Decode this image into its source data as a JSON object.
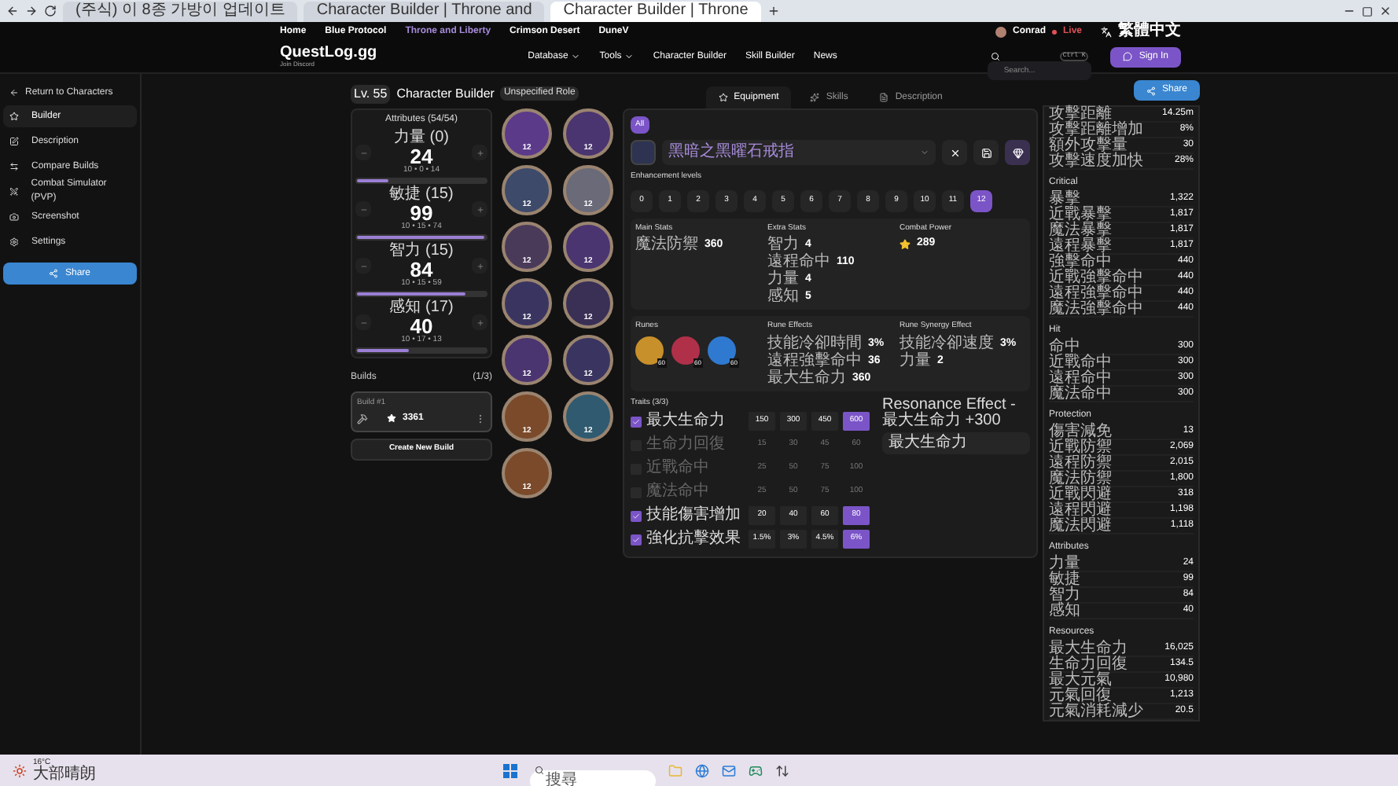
{
  "browser": {
    "tabs": [
      {
        "title": "(주식) 이 8종 가방이 업데이트",
        "selected": false
      },
      {
        "title": "Character Builder | Throne and",
        "selected": false
      },
      {
        "title": "Character Builder | Throne",
        "selected": true
      }
    ]
  },
  "site": {
    "games": [
      {
        "label": "Home",
        "selected": false
      },
      {
        "label": "Blue Protocol",
        "selected": false
      },
      {
        "label": "Throne and Liberty",
        "selected": true
      },
      {
        "label": "Crimson Desert",
        "selected": false
      },
      {
        "label": "DuneV",
        "selected": false
      }
    ],
    "user": "Conrad",
    "live": "Live",
    "language": "繁體中文",
    "logo": "QuestLog.gg",
    "discord": "Join Discord",
    "nav": [
      {
        "label": "Database",
        "dropdown": true
      },
      {
        "label": "Tools",
        "dropdown": true
      },
      {
        "label": "Character Builder",
        "dropdown": false
      },
      {
        "label": "Skill Builder",
        "dropdown": false
      },
      {
        "label": "News",
        "dropdown": false
      }
    ],
    "search": {
      "placeholder": "Search...",
      "shortcut": "Ctrl K"
    },
    "sign_in": "Sign In"
  },
  "sidebar": {
    "back": "Return to Characters",
    "items": [
      {
        "label": "Builder",
        "selected": true
      },
      {
        "label": "Description",
        "selected": false
      },
      {
        "label": "Compare Builds",
        "selected": false
      },
      {
        "label": "Combat Simulator (PVP)",
        "selected": false
      },
      {
        "label": "Screenshot",
        "selected": false
      },
      {
        "label": "Settings",
        "selected": false
      }
    ],
    "share": "Share"
  },
  "header": {
    "level": "Lv. 55",
    "title": "Character Builder",
    "role": "Unspecified Role"
  },
  "attributes": {
    "title": "Attributes (54/54)",
    "items": [
      {
        "name": "力量 (0)",
        "value": "24",
        "breakdown": "10 • 0 • 14",
        "level": 0.24
      },
      {
        "name": "敏捷 (15)",
        "value": "99",
        "breakdown": "10 • 15 • 74",
        "level": 0.99
      },
      {
        "name": "智力 (15)",
        "value": "84",
        "breakdown": "10 • 15 • 59",
        "level": 0.84
      },
      {
        "name": "感知 (17)",
        "value": "40",
        "breakdown": "10 • 17 • 13",
        "level": 0.4
      }
    ]
  },
  "builds": {
    "title": "Builds",
    "count": "(1/3)",
    "items": [
      {
        "name": "Build #1",
        "score": "3361",
        "selected": true
      }
    ],
    "create": "Create New Build"
  },
  "slots": [
    {
      "enhancement": "12",
      "color": "#5b3a8a"
    },
    {
      "enhancement": "12",
      "color": "#4a3570"
    },
    {
      "enhancement": "12",
      "color": "#3d4a6a"
    },
    {
      "enhancement": "12",
      "color": "#6a6a78"
    },
    {
      "enhancement": "12",
      "color": "#4a3a5a"
    },
    {
      "enhancement": "12",
      "color": "#4a3570"
    },
    {
      "enhancement": "12",
      "color": "#3a3560"
    },
    {
      "enhancement": "12",
      "color": "#3a2f55"
    },
    {
      "enhancement": "12",
      "color": "#4a3570"
    },
    {
      "enhancement": "12",
      "color": "#3a3560"
    },
    {
      "enhancement": "12",
      "color": "#7a4a2a"
    },
    {
      "enhancement": "12",
      "color": "#2f5a70"
    },
    {
      "enhancement": "12",
      "color": "#7a4a2a"
    }
  ],
  "equipment": {
    "tabs": [
      {
        "label": "Equipment",
        "selected": true
      },
      {
        "label": "Skills",
        "selected": false
      },
      {
        "label": "Description",
        "selected": false
      }
    ],
    "filter": {
      "label": "All",
      "selected": true
    },
    "item": {
      "name": "黑暗之黑曜石戒指"
    },
    "enhancement": {
      "title": "Enhancement levels",
      "levels": [
        {
          "label": "0",
          "selected": false
        },
        {
          "label": "1",
          "selected": false
        },
        {
          "label": "2",
          "selected": false
        },
        {
          "label": "3",
          "selected": false
        },
        {
          "label": "4",
          "selected": false
        },
        {
          "label": "5",
          "selected": false
        },
        {
          "label": "6",
          "selected": false
        },
        {
          "label": "7",
          "selected": false
        },
        {
          "label": "8",
          "selected": false
        },
        {
          "label": "9",
          "selected": false
        },
        {
          "label": "10",
          "selected": false
        },
        {
          "label": "11",
          "selected": false
        },
        {
          "label": "12",
          "selected": true
        }
      ]
    },
    "stat_groups": [
      {
        "title": "Main Stats",
        "rows": [
          {
            "name": "魔法防禦",
            "value": "360"
          }
        ]
      },
      {
        "title": "Extra Stats",
        "rows": [
          {
            "name": "智力",
            "value": "4"
          },
          {
            "name": "遠程命中",
            "value": "110"
          },
          {
            "name": "力量",
            "value": "4"
          },
          {
            "name": "感知",
            "value": "5"
          }
        ]
      }
    ],
    "combat_power": {
      "title": "Combat Power",
      "value": "289"
    },
    "runes": {
      "title": "Runes",
      "items": [
        {
          "level": "60",
          "color": "#c8902a"
        },
        {
          "level": "60",
          "color": "#b0304a"
        },
        {
          "level": "60",
          "color": "#2f7ad0"
        }
      ]
    },
    "rune_groups": [
      {
        "title": "Rune Effects",
        "rows": [
          {
            "name": "技能冷卻時間",
            "value": "3%"
          },
          {
            "name": "遠程強擊命中",
            "value": "36"
          },
          {
            "name": "最大生命力",
            "value": "360"
          }
        ]
      },
      {
        "title": "Rune Synergy Effect",
        "rows": [
          {
            "name": "技能冷卻速度",
            "value": "3%"
          },
          {
            "name": "力量",
            "value": "2"
          }
        ]
      }
    ],
    "traits": {
      "title": "Traits (3/3)",
      "rows": [
        {
          "name": "最大生命力",
          "checked": true,
          "values": [
            {
              "label": "150",
              "selected": false
            },
            {
              "label": "300",
              "selected": false
            },
            {
              "label": "450",
              "selected": false
            },
            {
              "label": "600",
              "selected": true
            }
          ]
        },
        {
          "name": "生命力回復",
          "checked": false,
          "values": [
            {
              "label": "15",
              "selected": false
            },
            {
              "label": "30",
              "selected": false
            },
            {
              "label": "45",
              "selected": false
            },
            {
              "label": "60",
              "selected": false
            }
          ]
        },
        {
          "name": "近戰命中",
          "checked": false,
          "values": [
            {
              "label": "25",
              "selected": false
            },
            {
              "label": "50",
              "selected": false
            },
            {
              "label": "75",
              "selected": false
            },
            {
              "label": "100",
              "selected": false
            }
          ]
        },
        {
          "name": "魔法命中",
          "checked": false,
          "values": [
            {
              "label": "25",
              "selected": false
            },
            {
              "label": "50",
              "selected": false
            },
            {
              "label": "75",
              "selected": false
            },
            {
              "label": "100",
              "selected": false
            }
          ]
        },
        {
          "name": "技能傷害增加",
          "checked": true,
          "values": [
            {
              "label": "20",
              "selected": false
            },
            {
              "label": "40",
              "selected": false
            },
            {
              "label": "60",
              "selected": false
            },
            {
              "label": "80",
              "selected": true
            }
          ]
        },
        {
          "name": "強化抗擊效果",
          "checked": true,
          "values": [
            {
              "label": "1.5%",
              "selected": false
            },
            {
              "label": "3%",
              "selected": false
            },
            {
              "label": "4.5%",
              "selected": false
            },
            {
              "label": "6%",
              "selected": true
            }
          ]
        }
      ]
    },
    "resonance": {
      "title": "Resonance Effect - 最大生命力 +300",
      "value": "最大生命力"
    }
  },
  "stats_panel": {
    "share": "Share",
    "sections": [
      {
        "rows": [
          {
            "name": "攻擊距離",
            "value": "14.25m"
          },
          {
            "name": "攻擊距離增加",
            "value": "8%"
          },
          {
            "name": "額外攻擊量",
            "value": "30"
          },
          {
            "name": "攻擊速度加快",
            "value": "28%"
          }
        ]
      },
      {
        "title": "Critical",
        "rows": [
          {
            "name": "暴擊",
            "value": "1,322"
          },
          {
            "name": "近戰暴擊",
            "value": "1,817"
          },
          {
            "name": "魔法暴擊",
            "value": "1,817"
          },
          {
            "name": "遠程暴擊",
            "value": "1,817"
          },
          {
            "name": "強擊命中",
            "value": "440"
          },
          {
            "name": "近戰強擊命中",
            "value": "440"
          },
          {
            "name": "遠程強擊命中",
            "value": "440"
          },
          {
            "name": "魔法強擊命中",
            "value": "440"
          }
        ]
      },
      {
        "title": "Hit",
        "rows": [
          {
            "name": "命中",
            "value": "300"
          },
          {
            "name": "近戰命中",
            "value": "300"
          },
          {
            "name": "遠程命中",
            "value": "300"
          },
          {
            "name": "魔法命中",
            "value": "300"
          }
        ]
      },
      {
        "title": "Protection",
        "rows": [
          {
            "name": "傷害減免",
            "value": "13"
          },
          {
            "name": "近戰防禦",
            "value": "2,069"
          },
          {
            "name": "遠程防禦",
            "value": "2,015"
          },
          {
            "name": "魔法防禦",
            "value": "1,800"
          },
          {
            "name": "近戰閃避",
            "value": "318"
          },
          {
            "name": "遠程閃避",
            "value": "1,198"
          },
          {
            "name": "魔法閃避",
            "value": "1,118"
          }
        ]
      },
      {
        "title": "Attributes",
        "rows": [
          {
            "name": "力量",
            "value": "24"
          },
          {
            "name": "敏捷",
            "value": "99"
          },
          {
            "name": "智力",
            "value": "84"
          },
          {
            "name": "感知",
            "value": "40"
          }
        ]
      },
      {
        "title": "Resources",
        "rows": [
          {
            "name": "最大生命力",
            "value": "16,025"
          },
          {
            "name": "生命力回復",
            "value": "134.5"
          },
          {
            "name": "最大元氣",
            "value": "10,980"
          },
          {
            "name": "元氣回復",
            "value": "1,213"
          },
          {
            "name": "元氣消耗減少",
            "value": "20.5"
          }
        ]
      }
    ]
  },
  "taskbar": {
    "temperature": "16°C",
    "weather": "大部晴朗",
    "search": {
      "placeholder": "搜尋"
    }
  }
}
